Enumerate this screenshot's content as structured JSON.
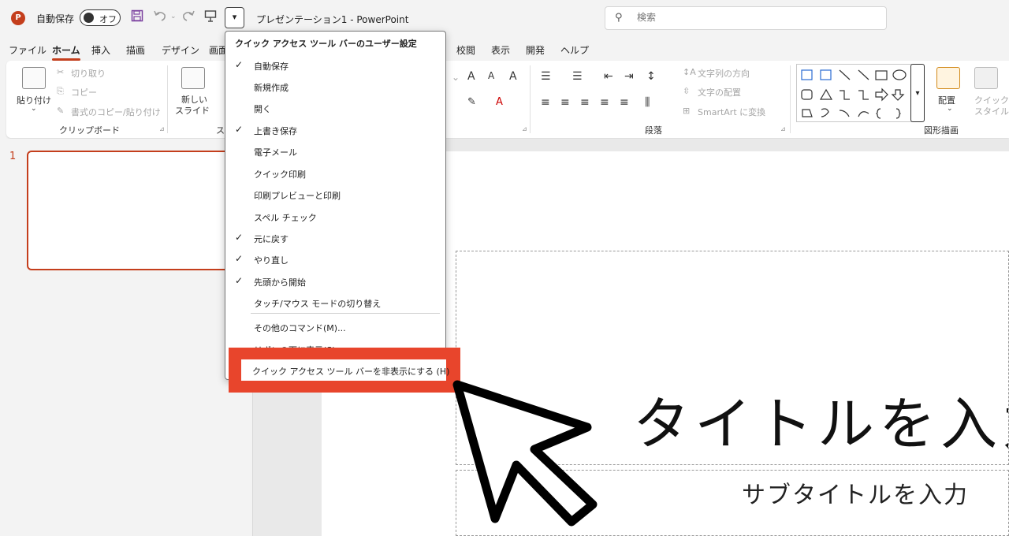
{
  "titlebar": {
    "app_logo": "P",
    "autosave_label": "自動保存",
    "autosave_state": "オフ",
    "customize_button": "▾",
    "doc_title": "プレゼンテーション1  -  PowerPoint",
    "search_placeholder": "検索",
    "icons": [
      "powerpoint-logo-icon",
      "save-icon",
      "undo-icon",
      "redo-icon",
      "present-icon"
    ]
  },
  "tabs": [
    "ファイル",
    "ホーム",
    "挿入",
    "描画",
    "デザイン",
    "画面",
    "校閲",
    "表示",
    "開発",
    "ヘルプ"
  ],
  "ribbon": {
    "clipboard": {
      "paste": "貼り付け",
      "cut": "切り取り",
      "copy": "コピー",
      "format_painter": "書式のコピー/貼り付け",
      "group": "クリップボード"
    },
    "slides": {
      "new_slide_line1": "新しい",
      "new_slide_line2": "スライド",
      "group": "ス"
    },
    "paragraph": {
      "text_direction": "文字列の方向",
      "align_text": "文字の配置",
      "smartart": "SmartArt に変換",
      "group": "段落"
    },
    "drawing": {
      "arrange": "配置",
      "quick_styles_line1": "クイック",
      "quick_styles_line2": "スタイル",
      "group": "図形描画"
    }
  },
  "slide_pane": {
    "slide_number": "1"
  },
  "slide": {
    "title_placeholder": "タイトルを入力",
    "subtitle_placeholder": "サブタイトルを入力"
  },
  "menu": {
    "header": "クイック アクセス ツール バーのユーザー設定",
    "items": [
      {
        "label": "自動保存",
        "checked": "✓"
      },
      {
        "label": "新規作成",
        "checked": ""
      },
      {
        "label": "開く",
        "checked": ""
      },
      {
        "label": "上書き保存",
        "checked": "✓"
      },
      {
        "label": "電子メール",
        "checked": ""
      },
      {
        "label": "クイック印刷",
        "checked": ""
      },
      {
        "label": "印刷プレビューと印刷",
        "checked": ""
      },
      {
        "label": "スペル チェック",
        "checked": ""
      },
      {
        "label": "元に戻す",
        "checked": "✓"
      },
      {
        "label": "やり直し",
        "checked": "✓"
      },
      {
        "label": "先頭から開始",
        "checked": "✓"
      },
      {
        "label": "タッチ/マウス モードの切り替え",
        "checked": ""
      }
    ],
    "more_commands": "その他のコマンド(M)...",
    "show_below": "リボンの下に表示(S)",
    "hide_toolbar": "クイック アクセス ツール バーを非表示にする (H)"
  },
  "colors": {
    "accent": "#c43e1c",
    "highlight": "#e8452c"
  }
}
